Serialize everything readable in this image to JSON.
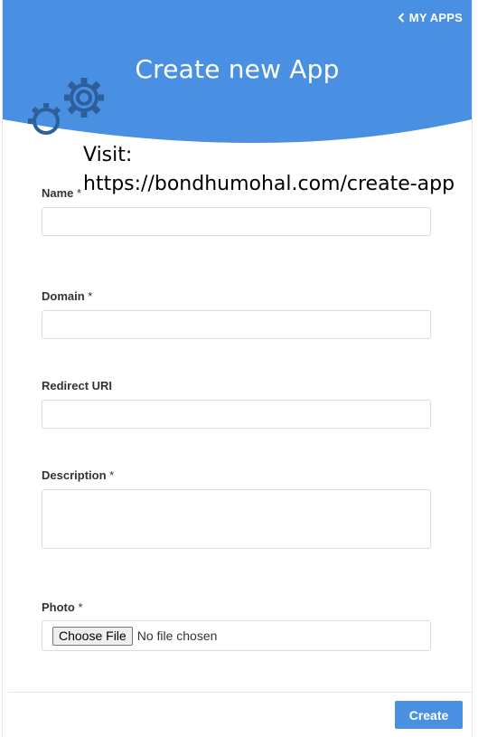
{
  "header": {
    "back_label": "MY APPS",
    "title": "Create new App",
    "accent_color": "#4a90e2"
  },
  "overlay": {
    "visit_line1": "Visit:",
    "visit_line2": "https://bondhumohal.com/create-app"
  },
  "form": {
    "name": {
      "label": "Name",
      "required_mark": "*",
      "value": ""
    },
    "domain": {
      "label": "Domain",
      "required_mark": "*",
      "value": ""
    },
    "redirect_uri": {
      "label": "Redirect URI",
      "value": ""
    },
    "description": {
      "label": "Description",
      "required_mark": "*",
      "value": ""
    },
    "photo": {
      "label": "Photo",
      "required_mark": "*",
      "button_label": "Choose File",
      "status": "No file chosen"
    }
  },
  "footer": {
    "create_label": "Create"
  },
  "icons": {
    "back": "chevron-left-icon",
    "decoration": "gears-icon"
  }
}
